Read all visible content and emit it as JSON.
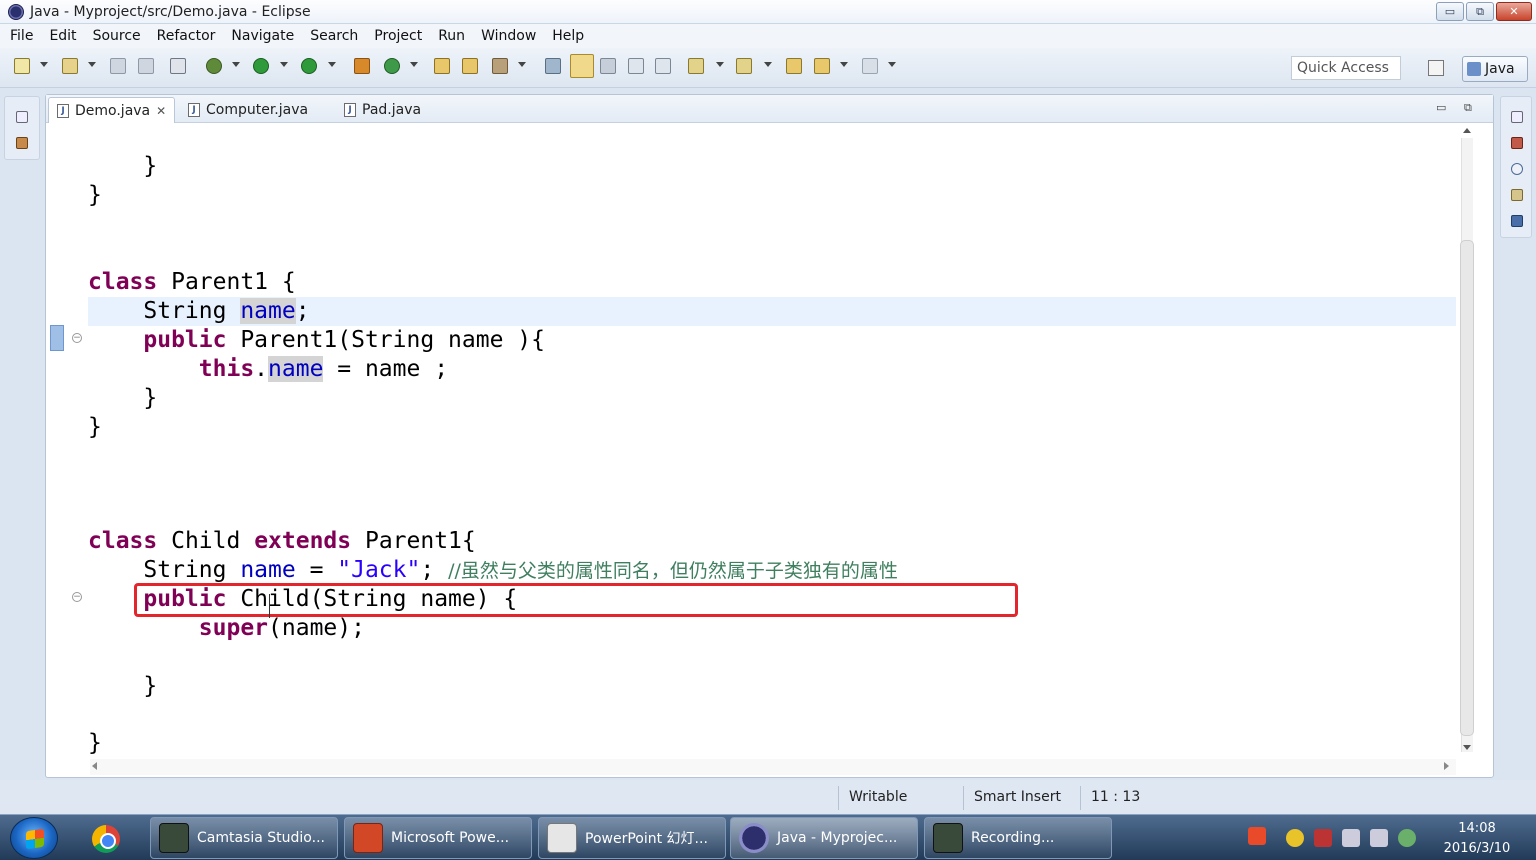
{
  "window": {
    "title": "Java - Myproject/src/Demo.java - Eclipse",
    "controls": [
      "▭",
      "⧉",
      "✕"
    ]
  },
  "menu": [
    "File",
    "Edit",
    "Source",
    "Refactor",
    "Navigate",
    "Search",
    "Project",
    "Run",
    "Window",
    "Help"
  ],
  "toolbar": {
    "quick_access_placeholder": "Quick Access",
    "perspective_label": "Java"
  },
  "editor": {
    "tabs": [
      {
        "label": "Demo.java",
        "active": true,
        "closable": true
      },
      {
        "label": "Computer.java",
        "active": false
      },
      {
        "label": "Pad.java",
        "active": false
      }
    ],
    "code": {
      "l1": "}",
      "l2": "}",
      "parent_decl_kw": "class",
      "parent_decl_rest": " Parent1 {",
      "parent_field_type": "String ",
      "parent_field_name": "name",
      "parent_field_end": ";",
      "parent_ctor_kw": "public",
      "parent_ctor_rest": " Parent1(String name ){",
      "this_kw": "this",
      "this_dot": ".",
      "this_field": "name",
      "this_rest": " = name ;",
      "l_close1": "}",
      "l_close2": "}",
      "child_decl_kw": "class",
      "child_decl_mid": " Child ",
      "child_extends_kw": "extends",
      "child_decl_rest": " Parent1{",
      "child_field_type": "String ",
      "child_field_name": "name",
      "child_field_eq": " = ",
      "child_field_str": "\"Jack\"",
      "child_field_end": "; ",
      "child_field_comment": "//虽然与父类的属性同名，但仍然属于子类独有的属性",
      "child_ctor_kw": "public",
      "child_ctor_rest": " Child(String name) {",
      "super_kw": "super",
      "super_rest": "(name);",
      "l_close3": "}",
      "l_close4": "}"
    }
  },
  "statusbar": {
    "mode": "Writable",
    "insert": "Smart Insert",
    "position": "11 : 13"
  },
  "taskbar": {
    "items": [
      {
        "label": "Camtasia Studio...",
        "color": "#3a4a3a"
      },
      {
        "label": "Microsoft Powe...",
        "color": "#d24726"
      },
      {
        "label": "PowerPoint 幻灯...",
        "color": "#c0c0c0"
      },
      {
        "label": "Java - Myprojec...",
        "color": "#2c2f6c"
      },
      {
        "label": "Recording...",
        "color": "#3a4a3a"
      }
    ],
    "clock_time": "14:08",
    "clock_date": "2016/3/10"
  }
}
